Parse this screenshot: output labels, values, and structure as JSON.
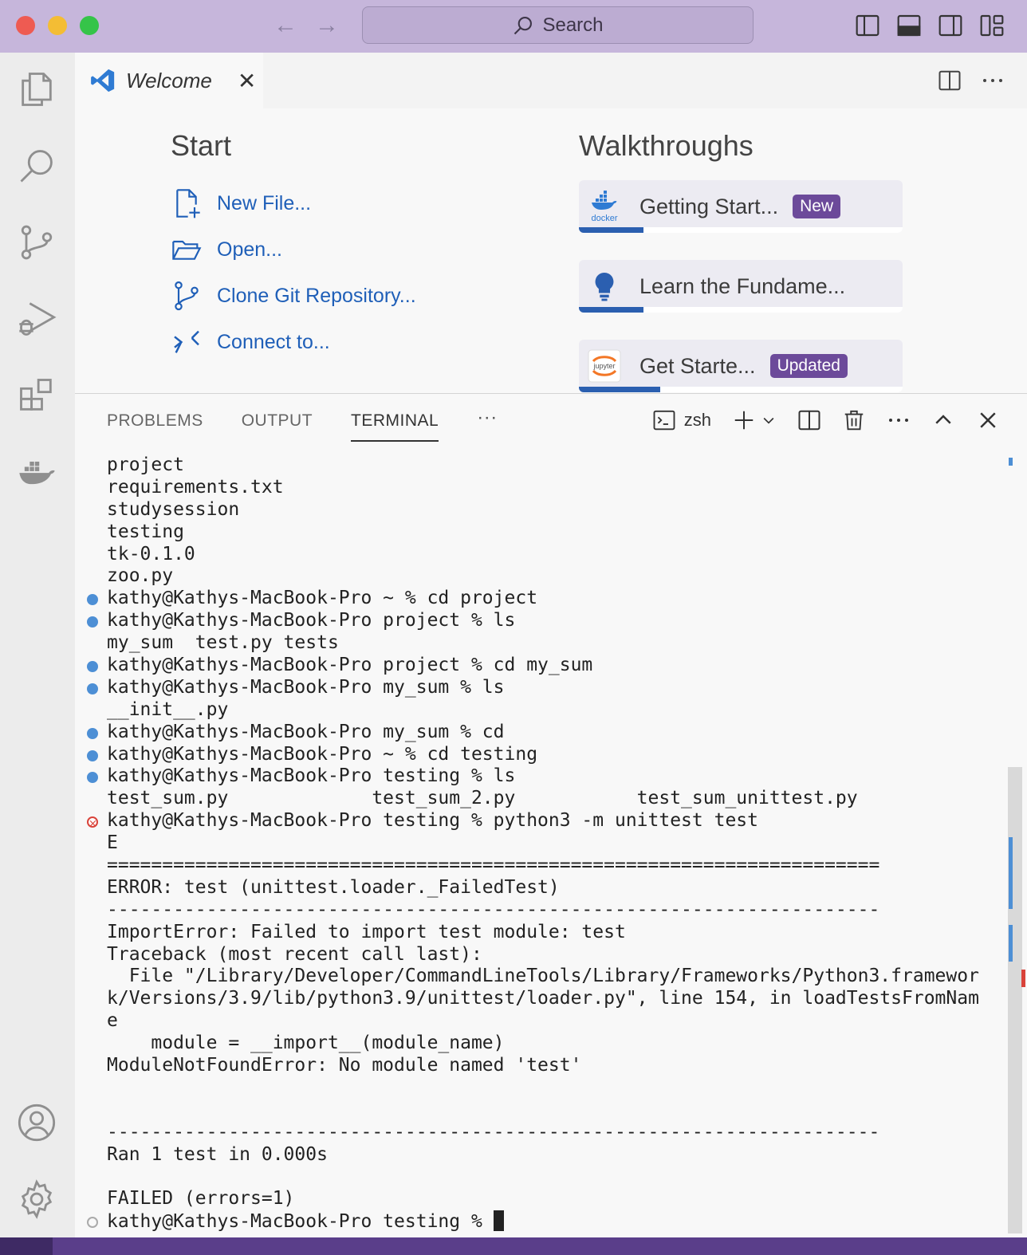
{
  "titlebar": {
    "search_placeholder": "Search",
    "icons": [
      "back-arrow-icon",
      "forward-arrow-icon",
      "search-icon",
      "toggle-primary-sidebar-icon",
      "toggle-panel-icon",
      "toggle-secondary-sidebar-icon",
      "customize-layout-icon"
    ]
  },
  "activitybar": {
    "items": [
      "explorer-icon",
      "search-icon",
      "source-control-icon",
      "run-debug-icon",
      "extensions-icon",
      "docker-icon",
      "account-icon",
      "settings-gear-icon"
    ]
  },
  "editor": {
    "tab_title": "Welcome",
    "start": {
      "title": "Start",
      "items": [
        {
          "label": "New File...",
          "icon": "new-file-icon"
        },
        {
          "label": "Open...",
          "icon": "folder-open-icon"
        },
        {
          "label": "Clone Git Repository...",
          "icon": "git-branch-icon"
        },
        {
          "label": "Connect to...",
          "icon": "remote-connect-icon"
        }
      ]
    },
    "walkthroughs": {
      "title": "Walkthroughs",
      "items": [
        {
          "label": "Getting Start...",
          "badge": "New",
          "icon": "docker-icon",
          "icon_text": "docker",
          "progress": 0.2
        },
        {
          "label": "Learn the Fundame...",
          "badge": "",
          "icon": "lightbulb-icon",
          "icon_text": "",
          "progress": 0.2
        },
        {
          "label": "Get Starte...",
          "badge": "Updated",
          "icon": "jupyter-icon",
          "icon_text": "jupyter",
          "progress": 0.25
        }
      ]
    }
  },
  "panel": {
    "tabs": [
      "PROBLEMS",
      "OUTPUT",
      "TERMINAL"
    ],
    "more": "···",
    "active_tab": "TERMINAL",
    "shell": "zsh"
  },
  "terminal": {
    "lines": [
      {
        "text": "project",
        "marker": ""
      },
      {
        "text": "requirements.txt",
        "marker": ""
      },
      {
        "text": "studysession",
        "marker": ""
      },
      {
        "text": "testing",
        "marker": ""
      },
      {
        "text": "tk-0.1.0",
        "marker": ""
      },
      {
        "text": "zoo.py",
        "marker": ""
      },
      {
        "text": "kathy@Kathys-MacBook-Pro ~ % cd project",
        "marker": "ok"
      },
      {
        "text": "kathy@Kathys-MacBook-Pro project % ls",
        "marker": "ok"
      },
      {
        "text": "my_sum  test.py tests",
        "marker": ""
      },
      {
        "text": "kathy@Kathys-MacBook-Pro project % cd my_sum",
        "marker": "ok"
      },
      {
        "text": "kathy@Kathys-MacBook-Pro my_sum % ls",
        "marker": "ok"
      },
      {
        "text": "__init__.py",
        "marker": ""
      },
      {
        "text": "kathy@Kathys-MacBook-Pro my_sum % cd",
        "marker": "ok"
      },
      {
        "text": "kathy@Kathys-MacBook-Pro ~ % cd testing",
        "marker": "ok"
      },
      {
        "text": "kathy@Kathys-MacBook-Pro testing % ls",
        "marker": "ok"
      },
      {
        "text": "test_sum.py             test_sum_2.py           test_sum_unittest.py",
        "marker": ""
      },
      {
        "text": "kathy@Kathys-MacBook-Pro testing % python3 -m unittest test",
        "marker": "err"
      },
      {
        "text": "E",
        "marker": ""
      },
      {
        "text": "======================================================================",
        "marker": ""
      },
      {
        "text": "ERROR: test (unittest.loader._FailedTest)",
        "marker": ""
      },
      {
        "text": "----------------------------------------------------------------------",
        "marker": ""
      },
      {
        "text": "ImportError: Failed to import test module: test",
        "marker": ""
      },
      {
        "text": "Traceback (most recent call last):",
        "marker": ""
      },
      {
        "text": "  File \"/Library/Developer/CommandLineTools/Library/Frameworks/Python3.framewor",
        "marker": ""
      },
      {
        "text": "k/Versions/3.9/lib/python3.9/unittest/loader.py\", line 154, in loadTestsFromNam",
        "marker": ""
      },
      {
        "text": "e",
        "marker": ""
      },
      {
        "text": "    module = __import__(module_name)",
        "marker": ""
      },
      {
        "text": "ModuleNotFoundError: No module named 'test'",
        "marker": ""
      },
      {
        "text": "",
        "marker": ""
      },
      {
        "text": "",
        "marker": ""
      },
      {
        "text": "----------------------------------------------------------------------",
        "marker": ""
      },
      {
        "text": "Ran 1 test in 0.000s",
        "marker": ""
      },
      {
        "text": "",
        "marker": ""
      },
      {
        "text": "FAILED (errors=1)",
        "marker": ""
      },
      {
        "text": "kathy@Kathys-MacBook-Pro testing % ",
        "marker": "idle",
        "cursor": true
      }
    ]
  },
  "colors": {
    "titlebar": "#c6b6db",
    "link": "#1f5fb8",
    "badge": "#6c4a9a",
    "statusbar": "#5a3e8a",
    "terminal_ok_dot": "#4d8fd5",
    "terminal_err_dot": "#d9433a"
  }
}
